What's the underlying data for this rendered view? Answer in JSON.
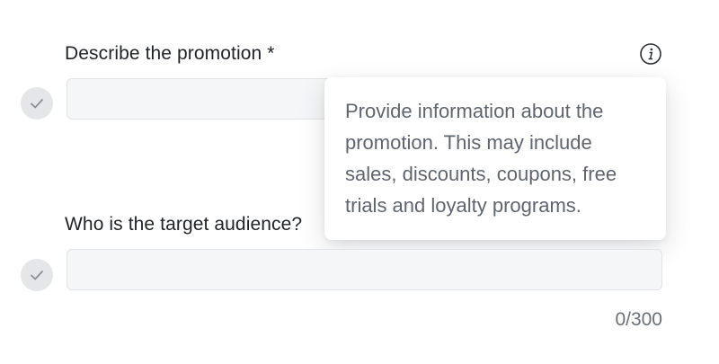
{
  "field_promotion": {
    "label": "Describe the promotion *",
    "value": "",
    "placeholder": ""
  },
  "info_tooltip": {
    "text": "Provide information about the promotion. This may include sales, discounts, coupons, free trials and loyalty programs."
  },
  "field_audience": {
    "label": "Who is the target audience?",
    "value": "",
    "placeholder": "",
    "counter": "0/300"
  },
  "icons": {
    "info": "info-icon",
    "check": "check-icon"
  },
  "colors": {
    "check_circle_bg": "#e4e6ea",
    "input_bg": "#f5f6f8",
    "tooltip_text": "#5f6570",
    "label_text": "#1f2328"
  }
}
